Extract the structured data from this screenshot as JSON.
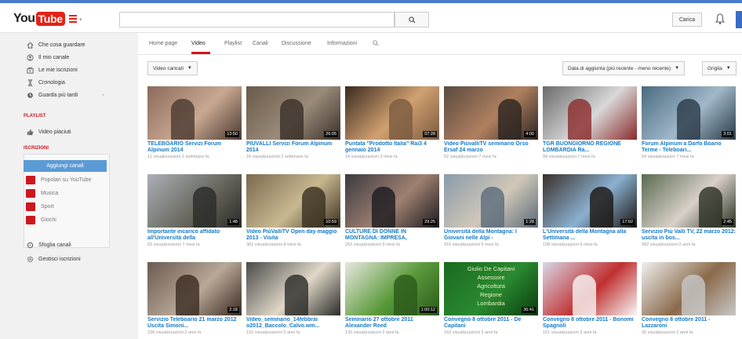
{
  "masthead": {
    "logo_you": "You",
    "logo_tube": "Tube",
    "upload_label": "Carica"
  },
  "sidebar": {
    "nav": [
      {
        "label": "Che cosa guardare",
        "icon": "home-icon"
      },
      {
        "label": "Il mio canale",
        "icon": "user-icon"
      },
      {
        "label": "Le mie iscrizioni",
        "icon": "subscriptions-icon"
      },
      {
        "label": "Cronologia",
        "icon": "history-icon"
      },
      {
        "label": "Guarda più tardi",
        "icon": "watch-later-icon"
      }
    ],
    "playlist_title": "PLAYLIST",
    "liked_label": "Video piaciuti",
    "subs_title": "ISCRIZIONI",
    "add_channels_label": "Aggiungi canali",
    "categories": [
      {
        "label": "Popolari su YouTube"
      },
      {
        "label": "Musica"
      },
      {
        "label": "Sport"
      },
      {
        "label": "Giochi"
      }
    ],
    "browse_label": "Sfoglia canali",
    "manage_label": "Gestisci iscrizioni"
  },
  "tabs": [
    {
      "label": "Home page"
    },
    {
      "label": "Video",
      "active": true
    },
    {
      "label": "Playlist"
    },
    {
      "label": "Canali"
    },
    {
      "label": "Discussione"
    },
    {
      "label": "Informazioni"
    }
  ],
  "toolbar": {
    "filter_label": "Video caricati",
    "sort_label": "Data di aggiunta (più recente - meno recente)",
    "view_label": "Griglia"
  },
  "videos": [
    {
      "title": "TELEBOARIO Servizi Forum Alpinum 2014",
      "meta": "11 visualizzazioni  2 settimane fa",
      "duration": "13:50",
      "palette": [
        "#8a6a5a",
        "#c9a892",
        "#4a3a30"
      ]
    },
    {
      "title": "PIUVALLI Servizi Forum Alpinum 2014",
      "meta": "16 visualizzazioni  2 settimane fa",
      "duration": "26:05",
      "palette": [
        "#6a5a4a",
        "#9a8a7a",
        "#3a3028"
      ]
    },
    {
      "title": "Puntata \"Prodotto Italia\" Rai3 4 gennaio 2014",
      "meta": "14 visualizzazioni  3 mesi fa",
      "duration": "07:28",
      "palette": [
        "#3a2a20",
        "#d0a070",
        "#7a5a40"
      ]
    },
    {
      "title": "Video PiùvalliTV seminario Orso Ersaf 24 marzo",
      "meta": "52 visualizzazioni  7 mesi fa",
      "duration": "4:00",
      "palette": [
        "#5a4a40",
        "#b08060",
        "#2a2420"
      ]
    },
    {
      "title": "TGR BUONGIORNO REGIONE LOMBARDIA Ra...",
      "meta": "84 visualizzazioni  7 mesi fa",
      "duration": "",
      "palette": [
        "#6a6a6a",
        "#d8d8d8",
        "#8a2a2a"
      ]
    },
    {
      "title": "Forum Alpinum a Darfo Boario Terme - Teleboari...",
      "meta": "54 visualizzazioni  7 mesi fa",
      "duration": "3:01",
      "palette": [
        "#4a6a80",
        "#a0b8c8",
        "#2a3a48"
      ]
    },
    {
      "title": "Importante incarico affidato all'Università della",
      "meta": "83 visualizzazioni  7 mesi fa",
      "duration": "1:48",
      "palette": [
        "#aab0b8",
        "#6a6a60",
        "#2a2a28"
      ]
    },
    {
      "title": "Video PiùValliTV Open day maggio 2013 - Visita",
      "meta": "382 visualizzazioni  8 mesi fa",
      "duration": "10:59",
      "palette": [
        "#7a6a50",
        "#c8b890",
        "#3a3020"
      ]
    },
    {
      "title": "CULTURE DI DONNE IN MONTAGNA: IMPRESA,",
      "meta": "262 visualizzazioni  9 mesi fa",
      "duration": "29:25",
      "palette": [
        "#3a3a40",
        "#a08070",
        "#1a1a20"
      ]
    },
    {
      "title": "Università della Montagna: I Giovani nelle Alpi -",
      "meta": "316 visualizzazioni  9 mesi fa",
      "duration": "1:28",
      "palette": [
        "#8a9aaa",
        "#d0c8b8",
        "#5a6a7a"
      ]
    },
    {
      "title": "L'Università della Montagna alla Settimana ...",
      "meta": "198 visualizzazioni  9 mesi fa",
      "duration": "17:02",
      "palette": [
        "#3a3028",
        "#8ab0d0",
        "#1a1410"
      ]
    },
    {
      "title": "Servizio Più Valli TV, 22 marzo 2012: uscita in bos...",
      "meta": "492 visualizzazioni  2 anni fa",
      "duration": "2:45",
      "palette": [
        "#5a6a50",
        "#d8d0c8",
        "#2a3020"
      ]
    },
    {
      "title": "Servizio Teleboario 21 marzo 2012 Uscita Simoni...",
      "meta": "238 visualizzazioni  2 anni fa",
      "duration": "2:18",
      "palette": [
        "#6a5a50",
        "#b8a898",
        "#3a2a20"
      ]
    },
    {
      "title": "Video_seminario_14febbrai o2012_Baccolo_Calvo.wm...",
      "meta": "192 visualizzazioni  2 anni fa",
      "duration": "",
      "palette": [
        "#4a4a48",
        "#e0d8c8",
        "#2a2a28"
      ]
    },
    {
      "title": "Seminario 27 ottobre 2011 Alexander Reed",
      "meta": "130 visualizzazioni  2 anni fa",
      "duration": "1:00:12",
      "palette": [
        "#e8e8e0",
        "#5a9a3a",
        "#2a5a1a"
      ]
    },
    {
      "title": "Convegno 8 ottobre 2011 - De Capitani",
      "meta": "163 visualizzazioni  2 anni fa",
      "duration": "36:41",
      "palette": [
        "#1a6a20",
        "#2a8a30",
        "#0a3a10"
      ],
      "slide": [
        "Giulio De Capitani",
        "Assessore",
        "Agricoltura",
        "Regione",
        "Lombardia"
      ]
    },
    {
      "title": "Convegno 8 ottobre 2011 - Bonomi Spagnoli",
      "meta": "101 visualizzazioni  2 anni fa",
      "duration": "",
      "palette": [
        "#d8d8e8",
        "#c03030",
        "#f8f8f8"
      ]
    },
    {
      "title": "Convegno 8 ottobre 2011 - Lazzaroni",
      "meta": "30 visualizzazioni  2 anni fa",
      "duration": "",
      "palette": [
        "#f0f0f0",
        "#8a6a4a",
        "#c8c8c8"
      ]
    }
  ]
}
